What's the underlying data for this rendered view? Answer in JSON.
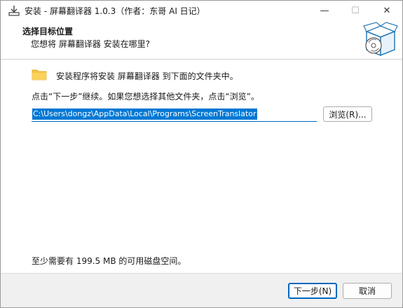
{
  "window": {
    "title": "安装 - 屏幕翻译器 1.0.3（作者：东哥 AI 日记）",
    "minimize_label": "—",
    "maximize_label": "☐",
    "close_label": "✕"
  },
  "header": {
    "title": "选择目标位置",
    "subtitle": "您想将 屏幕翻译器 安装在哪里?"
  },
  "body": {
    "info_text": "安装程序将安装 屏幕翻译器 到下面的文件夹中。",
    "instruction": "点击“下一步”继续。如果您想选择其他文件夹，点击“浏览”。",
    "install_path": "C:\\Users\\dongz\\AppData\\Local\\Programs\\ScreenTranslator",
    "browse_label": "浏览(R)...",
    "disk_space": "至少需要有 199.5 MB 的可用磁盘空间。"
  },
  "footer": {
    "next_label": "下一步(N)",
    "cancel_label": "取消"
  },
  "colors": {
    "accent": "#0078d4",
    "folder": "#f5c542"
  },
  "icons": {
    "title_icon": "installer-download-icon",
    "folder_icon": "folder-icon",
    "setup_art": "setup-box-cd-icon"
  }
}
